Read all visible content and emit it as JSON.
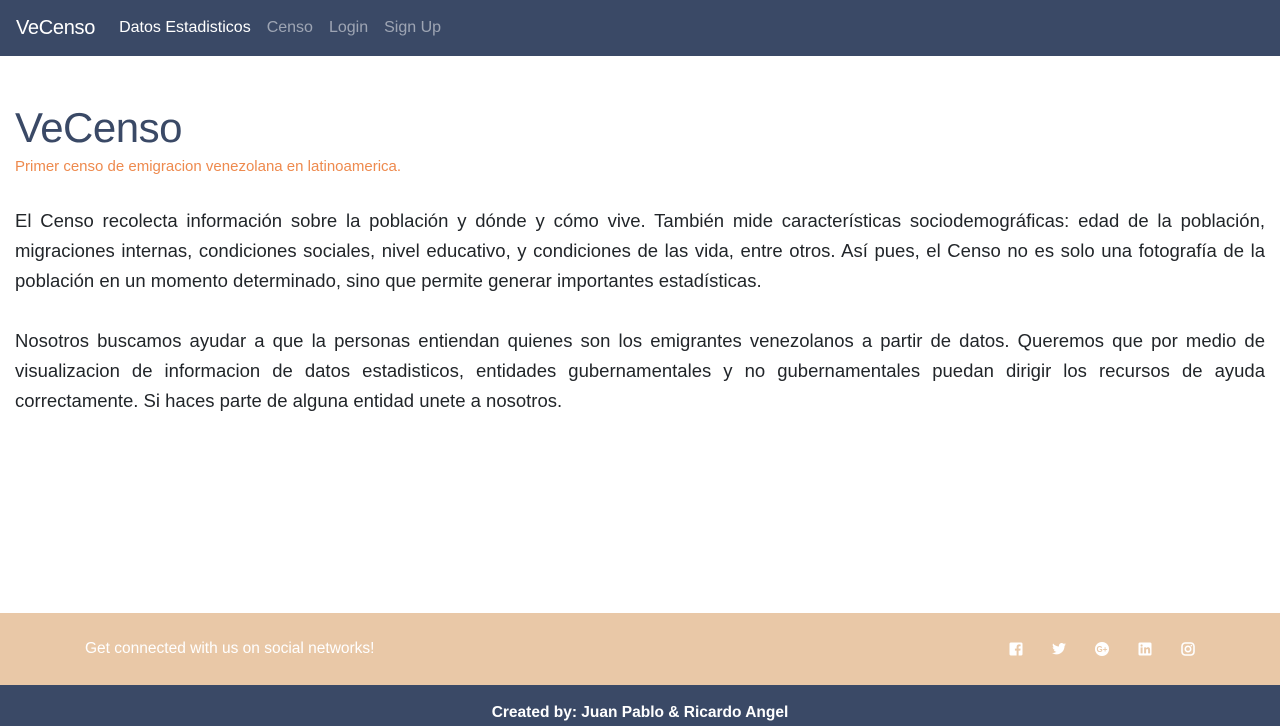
{
  "navbar": {
    "brand": "VeCenso",
    "links": [
      {
        "label": "Datos Estadisticos",
        "active": true
      },
      {
        "label": "Censo",
        "active": false
      },
      {
        "label": "Login",
        "active": false
      },
      {
        "label": "Sign Up",
        "active": false
      }
    ]
  },
  "main": {
    "title": "VeCenso",
    "subtitle": "Primer censo de emigracion venezolana en latinoamerica.",
    "paragraph1": "El Censo recolecta información sobre la población y dónde y cómo vive. También mide características sociodemográficas: edad de la población, migraciones internas, condiciones sociales, nivel educativo, y condiciones de las vida, entre otros. Así pues, el Censo no es solo una fotografía de la población en un momento determinado, sino que permite generar importantes estadísticas.",
    "paragraph2_text": "Nosotros buscamos ayudar a que la personas entiendan quienes son los emigrantes venezolanos a partir de datos. Queremos que por medio de visualizacion de informacion de datos estadisticos, entidades gubernamentales y no gubernamentales puedan dirigir los recursos de ayuda correctamente. Si haces parte de alguna entidad ",
    "paragraph2_link": "unete a nosotros",
    "paragraph2_end": "."
  },
  "social": {
    "text": "Get connected with us on social networks!",
    "icons": [
      "facebook-icon",
      "twitter-icon",
      "google-plus-icon",
      "linkedin-icon",
      "instagram-icon"
    ]
  },
  "footer": {
    "text": "Created by: Juan Pablo & Ricardo Angel"
  },
  "colors": {
    "navbar_bg": "#3a4966",
    "accent_orange": "#ee8a4e",
    "social_bar_bg": "#e9c8a7"
  }
}
